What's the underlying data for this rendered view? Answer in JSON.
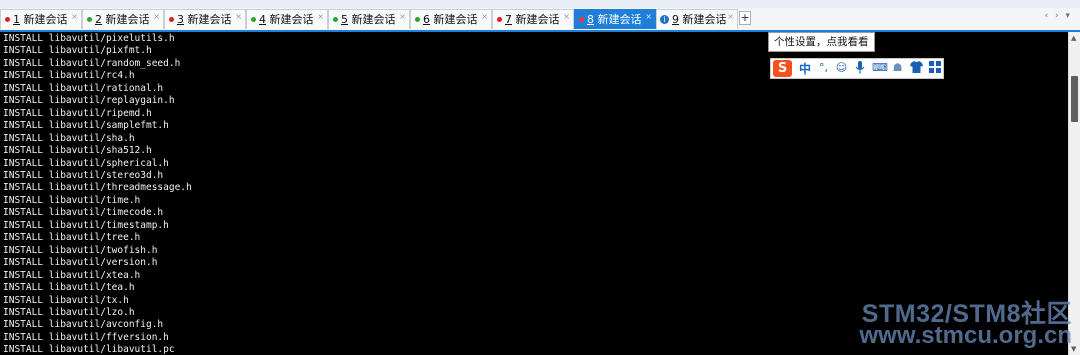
{
  "tabs": [
    {
      "number": "1",
      "label": "新建会话",
      "status": "red",
      "active": false
    },
    {
      "number": "2",
      "label": "新建会话",
      "status": "green",
      "active": false
    },
    {
      "number": "3",
      "label": "新建会话",
      "status": "red",
      "active": false
    },
    {
      "number": "4",
      "label": "新建会话",
      "status": "green",
      "active": false
    },
    {
      "number": "5",
      "label": "新建会话",
      "status": "green",
      "active": false
    },
    {
      "number": "6",
      "label": "新建会话",
      "status": "green",
      "active": false
    },
    {
      "number": "7",
      "label": "新建会话",
      "status": "red",
      "active": false
    },
    {
      "number": "8",
      "label": "新建会话",
      "status": "red",
      "active": true
    },
    {
      "number": "9",
      "label": "新建会话",
      "status": "info",
      "active": false
    }
  ],
  "new_tab_label": "+",
  "terminal_lines": [
    "INSTALL libavutil/pixelutils.h",
    "INSTALL libavutil/pixfmt.h",
    "INSTALL libavutil/random_seed.h",
    "INSTALL libavutil/rc4.h",
    "INSTALL libavutil/rational.h",
    "INSTALL libavutil/replaygain.h",
    "INSTALL libavutil/ripemd.h",
    "INSTALL libavutil/samplefmt.h",
    "INSTALL libavutil/sha.h",
    "INSTALL libavutil/sha512.h",
    "INSTALL libavutil/spherical.h",
    "INSTALL libavutil/stereo3d.h",
    "INSTALL libavutil/threadmessage.h",
    "INSTALL libavutil/time.h",
    "INSTALL libavutil/timecode.h",
    "INSTALL libavutil/timestamp.h",
    "INSTALL libavutil/tree.h",
    "INSTALL libavutil/twofish.h",
    "INSTALL libavutil/version.h",
    "INSTALL libavutil/xtea.h",
    "INSTALL libavutil/tea.h",
    "INSTALL libavutil/tx.h",
    "INSTALL libavutil/lzo.h",
    "INSTALL libavutil/avconfig.h",
    "INSTALL libavutil/ffversion.h",
    "INSTALL libavutil/libavutil.pc"
  ],
  "tooltip": "个性设置，点我看看",
  "ime_toolbar": {
    "logo_letter": "S",
    "mode_label": "中",
    "icons": [
      "punctuation-icon",
      "emoji-icon",
      "microphone-icon",
      "keyboard-icon",
      "user-icon",
      "skin-shirt-icon",
      "toolbox-icon"
    ]
  },
  "watermark": {
    "line1": "STM32/STM8社区",
    "line2": "www.stmcu.org.cn"
  },
  "colors": {
    "active_tab": "#1f7fd8",
    "terminal_bg": "#000000",
    "terminal_text": "#f2f2f2",
    "ime_logo": "#f4511e"
  }
}
